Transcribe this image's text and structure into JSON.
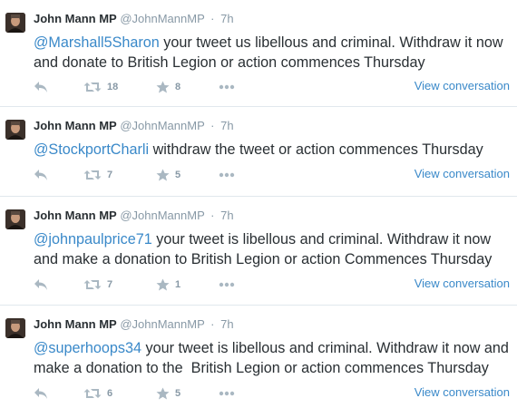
{
  "tweets": [
    {
      "author": "John Mann MP",
      "handle": "@JohnMannMP",
      "separator": "·",
      "time": "7h",
      "mention": "@Marshall5Sharon",
      "text": " your tweet us libellous and criminal. Withdraw it now and donate to British Legion or action commences Thursday",
      "retweets": "18",
      "favorites": "8",
      "view_label": "View conversation"
    },
    {
      "author": "John Mann MP",
      "handle": "@JohnMannMP",
      "separator": "·",
      "time": "7h",
      "mention": "@StockportCharli",
      "text": " withdraw the tweet or action commences Thursday",
      "retweets": "7",
      "favorites": "5",
      "view_label": "View conversation"
    },
    {
      "author": "John Mann MP",
      "handle": "@JohnMannMP",
      "separator": "·",
      "time": "7h",
      "mention": "@johnpaulprice71",
      "text": " your tweet is libellous and criminal. Withdraw it now and make a donation to British Legion or action Commences Thursday",
      "retweets": "7",
      "favorites": "1",
      "view_label": "View conversation"
    },
    {
      "author": "John Mann MP",
      "handle": "@JohnMannMP",
      "separator": "·",
      "time": "7h",
      "mention": "@superhoops34",
      "text": " your tweet is libellous and criminal. Withdraw it now and make a donation to the  British Legion or action commences Thursday",
      "retweets": "6",
      "favorites": "5",
      "view_label": "View conversation"
    }
  ],
  "icons": {
    "reply": "reply-icon",
    "retweet": "retweet-icon",
    "favorite": "star-icon",
    "more": "more-icon"
  },
  "colors": {
    "link": "#3a89c9",
    "muted": "#8899a6",
    "text": "#292f33"
  }
}
